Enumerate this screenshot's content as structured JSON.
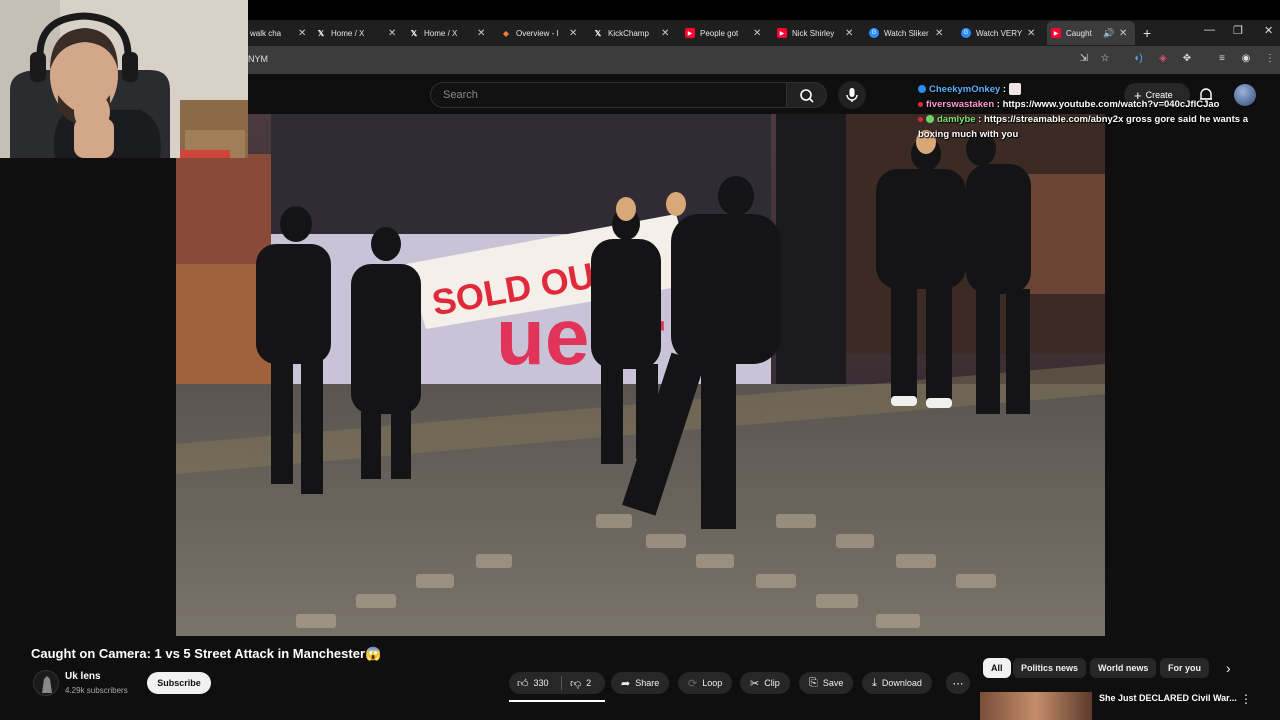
{
  "tabs": [
    {
      "title": "walk cha",
      "icon": "generic"
    },
    {
      "title": "Home / X",
      "icon": "x"
    },
    {
      "title": "Home / X",
      "icon": "x"
    },
    {
      "title": "Overview - I",
      "icon": "orange"
    },
    {
      "title": "KickChamp",
      "icon": "x"
    },
    {
      "title": "People got",
      "icon": "youtube"
    },
    {
      "title": "Nick Shirley",
      "icon": "youtube"
    },
    {
      "title": "Watch Sliker",
      "icon": "blue"
    },
    {
      "title": "Watch VERY",
      "icon": "blue"
    },
    {
      "title": "Caught",
      "icon": "youtube",
      "active": true
    }
  ],
  "address": {
    "text": "NYM"
  },
  "search": {
    "placeholder": "Search"
  },
  "header": {
    "create_label": "Create"
  },
  "chat": [
    {
      "user": "CheekymOnkey",
      "message": "",
      "user_color": "#5db0ff"
    },
    {
      "user": "fiverswastaken",
      "message": "https://www.youtube.com/watch?v=040cJflCJao",
      "user_color": "#ff9ad5"
    },
    {
      "user": "damlybe",
      "message": "https://streamable.com/abny2x gross gore said he wants a boxing much with you",
      "user_color": "#7ee36b"
    }
  ],
  "video": {
    "sign_text": "SOLD OUT",
    "banner_text": "ueer"
  },
  "title": "Caught on Camera: 1 vs 5 Street Attack in Manchester😱",
  "channel": {
    "name": "Uk lens",
    "subscribers": "4.29k subscribers"
  },
  "subscribe_label": "Subscribe",
  "actions": {
    "likes": "330",
    "dislikes": "2",
    "share": "Share",
    "loop": "Loop",
    "clip": "Clip",
    "save": "Save",
    "download": "Download"
  },
  "chips": [
    "All",
    "Politics news",
    "World news",
    "For you"
  ],
  "recommended": {
    "title": "She Just DECLARED Civil War..."
  }
}
